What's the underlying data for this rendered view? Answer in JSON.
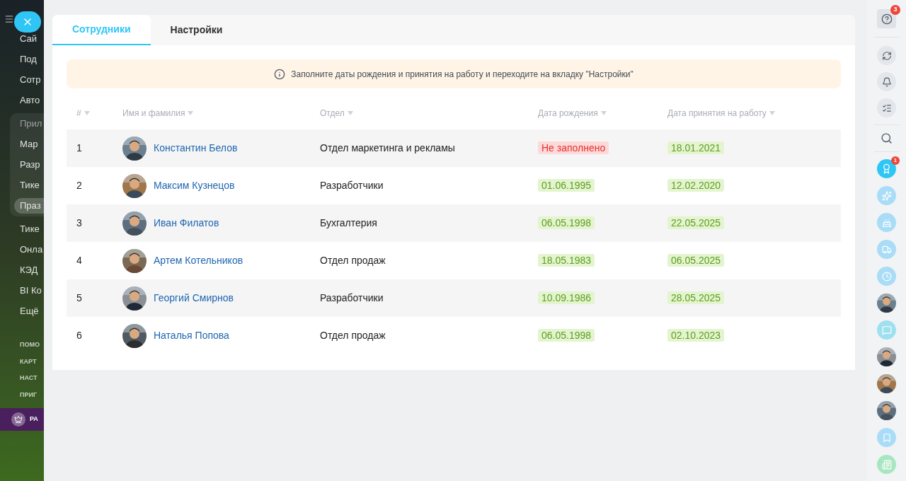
{
  "sidebar": {
    "items_top": [
      {
        "label": "Сай",
        "selected": false
      },
      {
        "label": "Под",
        "selected": false
      },
      {
        "label": "Сотр",
        "selected": false
      },
      {
        "label": "Авто",
        "selected": false
      }
    ],
    "group": {
      "title": "Прил",
      "items": [
        {
          "label": "Мар",
          "selected": false
        },
        {
          "label": "Разр",
          "selected": false
        },
        {
          "label": "Тике",
          "selected": false
        },
        {
          "label": "Праз",
          "selected": true
        }
      ]
    },
    "items_bottom": [
      {
        "label": "Тике",
        "selected": false
      },
      {
        "label": "Онла",
        "selected": false
      },
      {
        "label": "КЭД",
        "selected": false
      },
      {
        "label": "BI Ко",
        "selected": false
      },
      {
        "label": "Ещё",
        "selected": false
      }
    ],
    "links": [
      "ПОМО",
      "КАРТ",
      "НАСТ",
      "ПРИГ"
    ],
    "promo": "РА"
  },
  "tabs": [
    {
      "label": "Сотрудники",
      "selected": true
    },
    {
      "label": "Настройки",
      "selected": false
    }
  ],
  "notice": "Заполните даты рождения и принятия на работу и переходите на вкладку \"Настройки\"",
  "table": {
    "columns": [
      "#",
      "Имя и фамилия",
      "Отдел",
      "Дата рождения",
      "Дата принятия на работу"
    ],
    "rows": [
      {
        "num": "1",
        "name": "Константин Белов",
        "department": "Отдел маркетинга и рекламы",
        "birth": {
          "text": "Не заполнено",
          "kind": "missing"
        },
        "hired": {
          "text": "18.01.2021",
          "kind": "filled"
        }
      },
      {
        "num": "2",
        "name": "Максим Кузнецов",
        "department": "Разработчики",
        "birth": {
          "text": "01.06.1995",
          "kind": "filled"
        },
        "hired": {
          "text": "12.02.2020",
          "kind": "filled"
        }
      },
      {
        "num": "3",
        "name": "Иван Филатов",
        "department": "Бухгалтерия",
        "birth": {
          "text": "06.05.1998",
          "kind": "filled"
        },
        "hired": {
          "text": "22.05.2025",
          "kind": "filled"
        }
      },
      {
        "num": "4",
        "name": "Артем Котельников",
        "department": "Отдел продаж",
        "birth": {
          "text": "18.05.1983",
          "kind": "filled"
        },
        "hired": {
          "text": "06.05.2025",
          "kind": "filled"
        }
      },
      {
        "num": "5",
        "name": "Георгий Смирнов",
        "department": "Разработчики",
        "birth": {
          "text": "10.09.1986",
          "kind": "filled"
        },
        "hired": {
          "text": "28.05.2025",
          "kind": "filled"
        }
      },
      {
        "num": "6",
        "name": "Наталья Попова",
        "department": "Отдел продаж",
        "birth": {
          "text": "06.05.1998",
          "kind": "filled"
        },
        "hired": {
          "text": "02.10.2023",
          "kind": "filled"
        }
      }
    ]
  },
  "right_bar": {
    "help_badge": "3",
    "award_badge": "1"
  }
}
